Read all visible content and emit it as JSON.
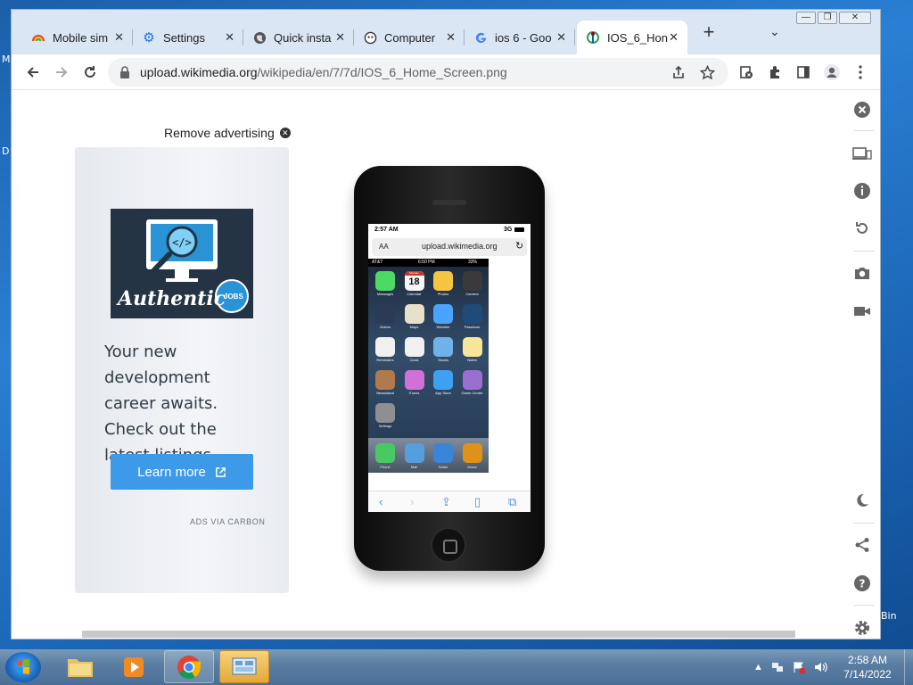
{
  "desktop": {
    "left_label_1": "M",
    "left_label_2": "D",
    "right_label": "Bin"
  },
  "window": {
    "buttons": [
      "minimize",
      "maximize",
      "close"
    ]
  },
  "tabs": [
    {
      "title": "Mobile sim",
      "icon": "chrome-rainbow-icon"
    },
    {
      "title": "Settings",
      "icon": "gear-icon"
    },
    {
      "title": "Quick insta",
      "icon": "globe-icon"
    },
    {
      "title": "Computer",
      "icon": "app-icon"
    },
    {
      "title": "ios 6 - Goo",
      "icon": "google-icon"
    },
    {
      "title": "IOS_6_Hon",
      "icon": "wikimedia-icon",
      "active": true
    }
  ],
  "toolbar": {
    "url_host": "upload.wikimedia.org",
    "url_path": "/wikipedia/en/7/7d/IOS_6_Home_Screen.png"
  },
  "ad": {
    "remove_label": "Remove advertising",
    "brand_text": "Authentic",
    "badge_text": "JOBS",
    "body": "Your new development career awaits. Check out the latest listings.",
    "cta": "Learn more",
    "attribution": "ADS VIA CARBON"
  },
  "phone": {
    "status_time": "2:57 AM",
    "status_net": "3G",
    "address_left": "AA",
    "address_host": "upload.wikimedia.org",
    "ios_carrier": "AT&T",
    "ios_time": "6:50 PM",
    "ios_battery": "33%",
    "calendar_day": "Monday",
    "calendar_date": "18",
    "apps": [
      "Messages",
      "Calendar",
      "Photos",
      "Camera",
      "Videos",
      "Maps",
      "Weather",
      "Passbook",
      "Reminders",
      "Clock",
      "Stocks",
      "Notes",
      "Newsstand",
      "iTunes",
      "App Store",
      "Game Center",
      "Settings"
    ],
    "dock": [
      "Phone",
      "Mail",
      "Safari",
      "Music"
    ]
  },
  "taskbar": {
    "time": "2:58 AM",
    "date": "7/14/2022"
  }
}
